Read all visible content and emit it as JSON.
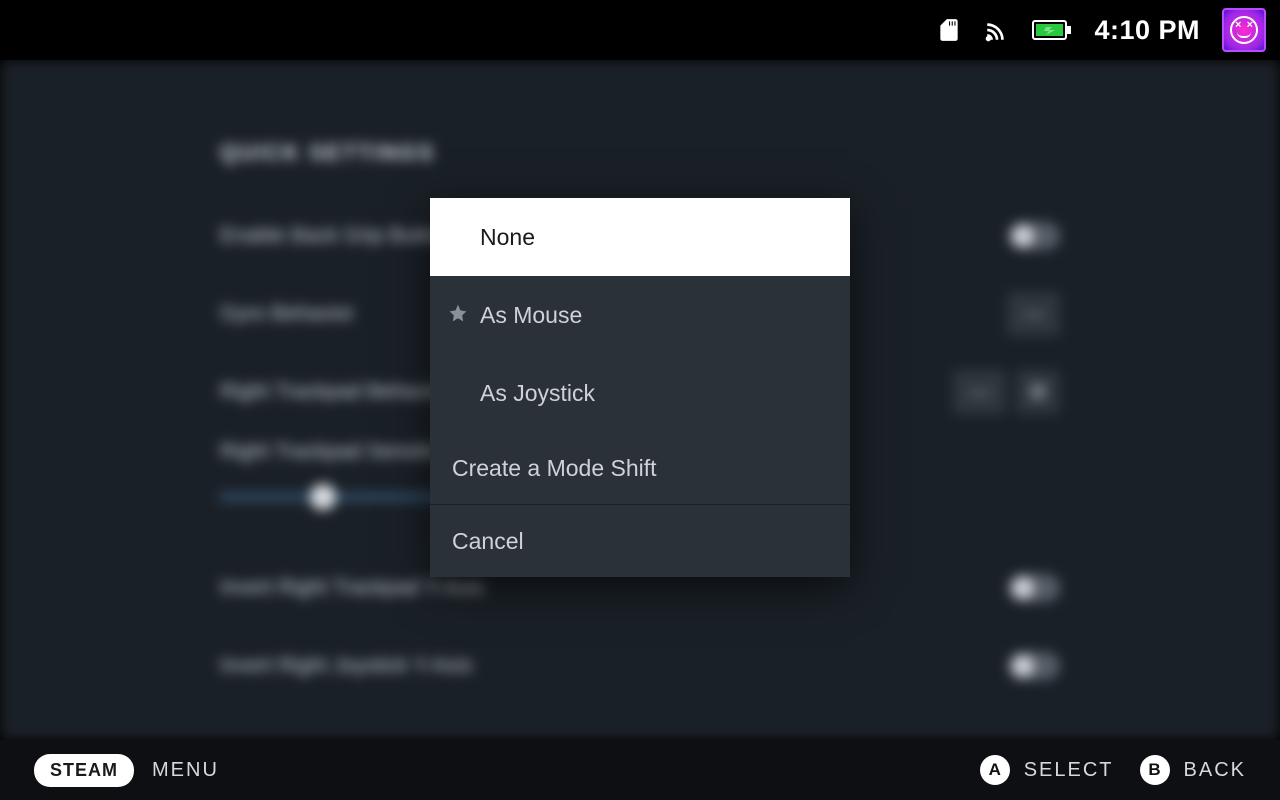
{
  "status": {
    "time": "4:10 PM"
  },
  "background": {
    "section_title": "QUICK SETTINGS",
    "rows": {
      "back_grip": "Enable Back Grip Buttons",
      "gyro": "Gyro Behavior",
      "rt_behavior": "Right Trackpad Behavior",
      "rt_sensitivity": "Right Trackpad Sensitivity",
      "invert_trackpad": "Invert Right Trackpad Y-Axis",
      "invert_joystick": "Invert Right Joystick Y-Axis"
    }
  },
  "modal": {
    "options": [
      {
        "label": "None",
        "selected": true,
        "recommended": false
      },
      {
        "label": "As Mouse",
        "selected": false,
        "recommended": true
      },
      {
        "label": "As Joystick",
        "selected": false,
        "recommended": false
      }
    ],
    "create_mode_shift": "Create a Mode Shift",
    "cancel": "Cancel"
  },
  "footer": {
    "steam": "STEAM",
    "menu": "MENU",
    "a_glyph": "A",
    "a_label": "SELECT",
    "b_glyph": "B",
    "b_label": "BACK"
  }
}
